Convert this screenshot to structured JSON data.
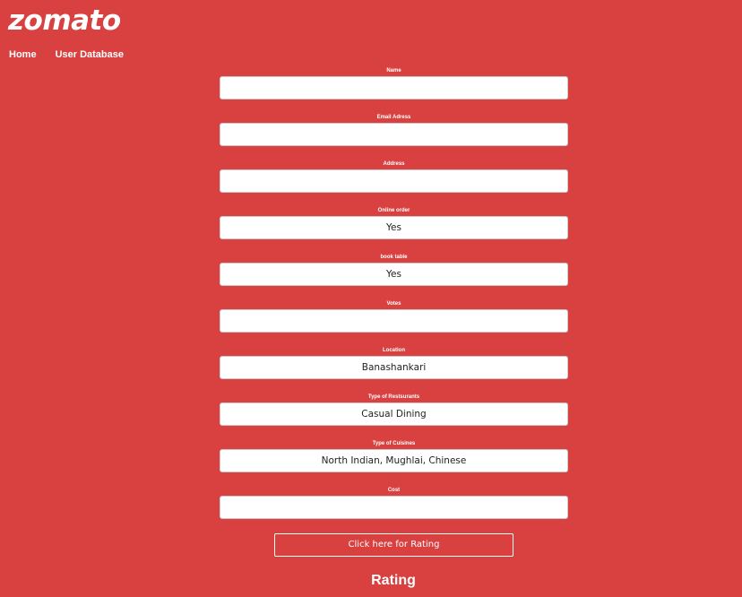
{
  "brand": {
    "logo_text": "zomato"
  },
  "nav": {
    "items": [
      {
        "label": "Home"
      },
      {
        "label": "User Database"
      }
    ]
  },
  "form": {
    "fields": [
      {
        "label": "Name",
        "value": ""
      },
      {
        "label": "Email Adress",
        "value": ""
      },
      {
        "label": "Address",
        "value": ""
      },
      {
        "label": "Online order",
        "value": "Yes"
      },
      {
        "label": "book table",
        "value": "Yes"
      },
      {
        "label": "Votes",
        "value": ""
      },
      {
        "label": "Location",
        "value": "Banashankari"
      },
      {
        "label": "Type of Restsurants",
        "value": "Casual Dining"
      },
      {
        "label": "Type of Cuisines",
        "value": "North Indian, Mughlai, Chinese"
      },
      {
        "label": "Cost",
        "value": ""
      }
    ],
    "submit_label": "Click here for Rating"
  },
  "result": {
    "heading": "Rating"
  },
  "colors": {
    "background": "#d94040",
    "text": "#ffffff",
    "input_background": "#ffffff"
  }
}
